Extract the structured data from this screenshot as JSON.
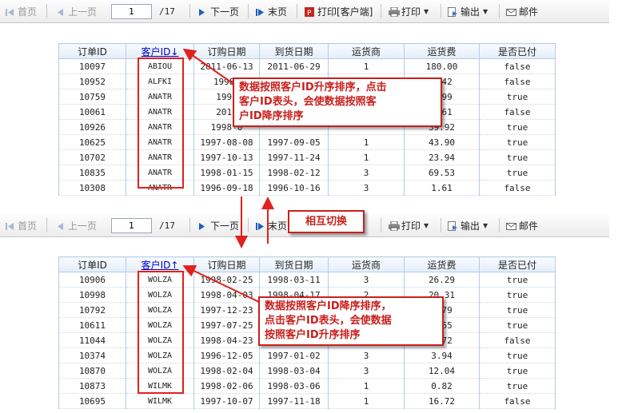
{
  "toolbar": {
    "first": "首页",
    "prev": "上一页",
    "page": "1",
    "total": "/17",
    "next": "下一页",
    "last": "末页",
    "print_client": "打印[客户端]",
    "print": "打印",
    "export": "输出",
    "mail": "邮件"
  },
  "columns": [
    "订单ID",
    "客户ID↓",
    "订购日期",
    "到货日期",
    "运货商",
    "运货费",
    "是否已付"
  ],
  "columns_asc": [
    "订单ID",
    "客户ID↑",
    "订购日期",
    "到货日期",
    "运货商",
    "运货费",
    "是否已付"
  ],
  "table1": [
    [
      "10097",
      "ABIOU",
      "2011-06-13",
      "2011-06-29",
      "1",
      "180.00",
      "false"
    ],
    [
      "10952",
      "ALFKI",
      "1998-",
      "",
      "",
      "0.42",
      "false"
    ],
    [
      "10759",
      "ANATR",
      "1991",
      "",
      "",
      "1.99",
      "true"
    ],
    [
      "10061",
      "ANATR",
      "2011",
      "",
      "",
      "1.61",
      "false"
    ],
    [
      "10926",
      "ANATR",
      "1998-0",
      "",
      "",
      "39.92",
      "true"
    ],
    [
      "10625",
      "ANATR",
      "1997-08-08",
      "1997-09-05",
      "1",
      "43.90",
      "true"
    ],
    [
      "10702",
      "ANATR",
      "1997-10-13",
      "1997-11-24",
      "1",
      "23.94",
      "true"
    ],
    [
      "10835",
      "ANATR",
      "1998-01-15",
      "1998-02-12",
      "3",
      "69.53",
      "true"
    ],
    [
      "10308",
      "ANATR",
      "1996-09-18",
      "1996-10-16",
      "3",
      "1.61",
      "false"
    ]
  ],
  "table2": [
    [
      "10906",
      "WOLZA",
      "1998-02-25",
      "1998-03-11",
      "3",
      "26.29",
      "true"
    ],
    [
      "10998",
      "WOLZA",
      "1998-04-03",
      "1998-04-17",
      "2",
      "20.31",
      "true"
    ],
    [
      "10792",
      "WOLZA",
      "1997-12-23",
      "",
      "",
      "4.79",
      "true"
    ],
    [
      "10611",
      "WOLZA",
      "1997-07-25",
      "",
      "",
      "6.65",
      "true"
    ],
    [
      "11044",
      "WOLZA",
      "1998-04-23",
      "",
      "",
      "8.72",
      "false"
    ],
    [
      "10374",
      "WOLZA",
      "1996-12-05",
      "1997-01-02",
      "3",
      "3.94",
      "true"
    ],
    [
      "10870",
      "WOLZA",
      "1998-02-04",
      "1998-03-04",
      "3",
      "12.04",
      "true"
    ],
    [
      "10873",
      "WILMK",
      "1998-02-06",
      "1998-03-06",
      "1",
      "0.82",
      "true"
    ],
    [
      "10695",
      "WILMK",
      "1997-10-07",
      "1997-11-18",
      "1",
      "16.72",
      "false"
    ]
  ],
  "annotations": {
    "asc_note": "数据按照客户ID升序排序，点击客户ID表头，会使数据按照客户ID降序排序",
    "asc_note_lines": [
      "数据按照客户ID升序排序，点击",
      "客户ID表头，会使数据按照客",
      "户ID降序排序"
    ],
    "toggle": "相互切换",
    "desc_note_lines": [
      "数据按照客户ID降序排序，",
      "点击客户ID表头，会使数据",
      "按照客户ID升序排序"
    ]
  },
  "colors": {
    "annotation_red": "#e0211c",
    "header_border": "#b8cce4",
    "link_blue": "#0000cc"
  }
}
